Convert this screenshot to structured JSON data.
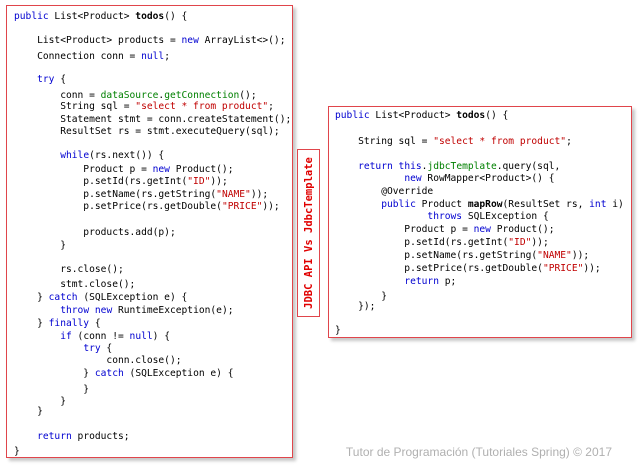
{
  "side_label": "JDBC API Vs JdbcTemplate",
  "footer": "Tutor de Programación (Tutoriales Spring) © 2017",
  "colors": {
    "keyword": "#0000d0",
    "string": "#c00000",
    "method": "#008000",
    "border": "#e0454b",
    "label": "#e00000"
  },
  "left_code": [
    [
      [
        "kw",
        "public"
      ],
      [
        "t",
        " List<Product> "
      ],
      [
        "b",
        "todos"
      ],
      [
        "t",
        "() {"
      ]
    ],
    [
      [
        "t",
        "    List<Product> products = "
      ],
      [
        "kw",
        "new"
      ],
      [
        "t",
        " ArrayList<>();"
      ]
    ],
    [
      [
        "t",
        "    Connection conn = "
      ],
      [
        "kw",
        "null"
      ],
      [
        "t",
        ";"
      ]
    ],
    [
      [
        "t",
        "    "
      ],
      [
        "kw",
        "try"
      ],
      [
        "t",
        " {"
      ]
    ],
    [
      [
        "t",
        "        conn = "
      ],
      [
        "call",
        "dataSource"
      ],
      [
        "t",
        "."
      ],
      [
        "call",
        "getConnection"
      ],
      [
        "t",
        "();"
      ]
    ],
    [
      [
        "t",
        "        String sql = "
      ],
      [
        "str",
        "\"select * from product\""
      ],
      [
        "t",
        ";"
      ]
    ],
    [
      [
        "t",
        "        Statement stmt = conn.createStatement();"
      ]
    ],
    [
      [
        "t",
        "        ResultSet rs = stmt.executeQuery(sql);"
      ]
    ],
    [
      [
        "t",
        "        "
      ],
      [
        "kw",
        "while"
      ],
      [
        "t",
        "(rs.next()) {"
      ]
    ],
    [
      [
        "t",
        "            Product p = "
      ],
      [
        "kw",
        "new"
      ],
      [
        "t",
        " Product();"
      ]
    ],
    [
      [
        "t",
        "            p.setId(rs.getInt("
      ],
      [
        "str",
        "\"ID\""
      ],
      [
        "t",
        "));"
      ]
    ],
    [
      [
        "t",
        "            p.setName(rs.getString("
      ],
      [
        "str",
        "\"NAME\""
      ],
      [
        "t",
        "));"
      ]
    ],
    [
      [
        "t",
        "            p.setPrice(rs.getDouble("
      ],
      [
        "str",
        "\"PRICE\""
      ],
      [
        "t",
        "));"
      ]
    ],
    [
      [
        "t",
        "            products.add(p);"
      ]
    ],
    [
      [
        "t",
        "        }"
      ]
    ],
    [
      [
        "t",
        "        rs.close();"
      ]
    ],
    [
      [
        "t",
        "        stmt.close();"
      ]
    ],
    [
      [
        "t",
        "    } "
      ],
      [
        "kw",
        "catch"
      ],
      [
        "t",
        " (SQLException e) {"
      ]
    ],
    [
      [
        "t",
        "        "
      ],
      [
        "kw",
        "throw"
      ],
      [
        "t",
        " "
      ],
      [
        "kw",
        "new"
      ],
      [
        "t",
        " RuntimeException(e);"
      ]
    ],
    [
      [
        "t",
        "    } "
      ],
      [
        "kw",
        "finally"
      ],
      [
        "t",
        " {"
      ]
    ],
    [
      [
        "t",
        "        "
      ],
      [
        "kw",
        "if"
      ],
      [
        "t",
        " (conn != "
      ],
      [
        "kw",
        "null"
      ],
      [
        "t",
        ") {"
      ]
    ],
    [
      [
        "t",
        "            "
      ],
      [
        "kw",
        "try"
      ],
      [
        "t",
        " {"
      ]
    ],
    [
      [
        "t",
        "                conn.close();"
      ]
    ],
    [
      [
        "t",
        "            } "
      ],
      [
        "kw",
        "catch"
      ],
      [
        "t",
        " (SQLException e) {"
      ]
    ],
    [
      [
        "t",
        "            }"
      ]
    ],
    [
      [
        "t",
        "        }"
      ]
    ],
    [
      [
        "t",
        "    }"
      ]
    ],
    [
      [
        "t",
        "    "
      ],
      [
        "kw",
        "return"
      ],
      [
        "t",
        " products;"
      ]
    ],
    [
      [
        "t",
        "}"
      ]
    ]
  ],
  "right_code": [
    [
      [
        "kw",
        "public"
      ],
      [
        "t",
        " List<Product> "
      ],
      [
        "b",
        "todos"
      ],
      [
        "t",
        "() {"
      ]
    ],
    [
      [
        "t",
        "    String sql = "
      ],
      [
        "str",
        "\"select * from product\""
      ],
      [
        "t",
        ";"
      ]
    ],
    [
      [
        "t",
        "    "
      ],
      [
        "kw",
        "return"
      ],
      [
        "t",
        " "
      ],
      [
        "kw",
        "this"
      ],
      [
        "t",
        "."
      ],
      [
        "call",
        "jdbcTemplate"
      ],
      [
        "t",
        ".query(sql,"
      ]
    ],
    [
      [
        "t",
        "            "
      ],
      [
        "kw",
        "new"
      ],
      [
        "t",
        " RowMapper<Product>() {"
      ]
    ],
    [
      [
        "t",
        "        @Override"
      ]
    ],
    [
      [
        "t",
        "        "
      ],
      [
        "kw",
        "public"
      ],
      [
        "t",
        " Product "
      ],
      [
        "b",
        "mapRow"
      ],
      [
        "t",
        "(ResultSet rs, "
      ],
      [
        "kw",
        "int"
      ],
      [
        "t",
        " i)"
      ]
    ],
    [
      [
        "t",
        "                "
      ],
      [
        "kw",
        "throws"
      ],
      [
        "t",
        " SQLException {"
      ]
    ],
    [
      [
        "t",
        "            Product p = "
      ],
      [
        "kw",
        "new"
      ],
      [
        "t",
        " Product();"
      ]
    ],
    [
      [
        "t",
        "            p.setId(rs.getInt("
      ],
      [
        "str",
        "\"ID\""
      ],
      [
        "t",
        "));"
      ]
    ],
    [
      [
        "t",
        "            p.setName(rs.getString("
      ],
      [
        "str",
        "\"NAME\""
      ],
      [
        "t",
        "));"
      ]
    ],
    [
      [
        "t",
        "            p.setPrice(rs.getDouble("
      ],
      [
        "str",
        "\"PRICE\""
      ],
      [
        "t",
        "));"
      ]
    ],
    [
      [
        "t",
        "            "
      ],
      [
        "kw",
        "return"
      ],
      [
        "t",
        " p;"
      ]
    ],
    [
      [
        "t",
        "        }"
      ]
    ],
    [
      [
        "t",
        "    });"
      ]
    ],
    [
      [
        "t",
        "}"
      ]
    ]
  ]
}
